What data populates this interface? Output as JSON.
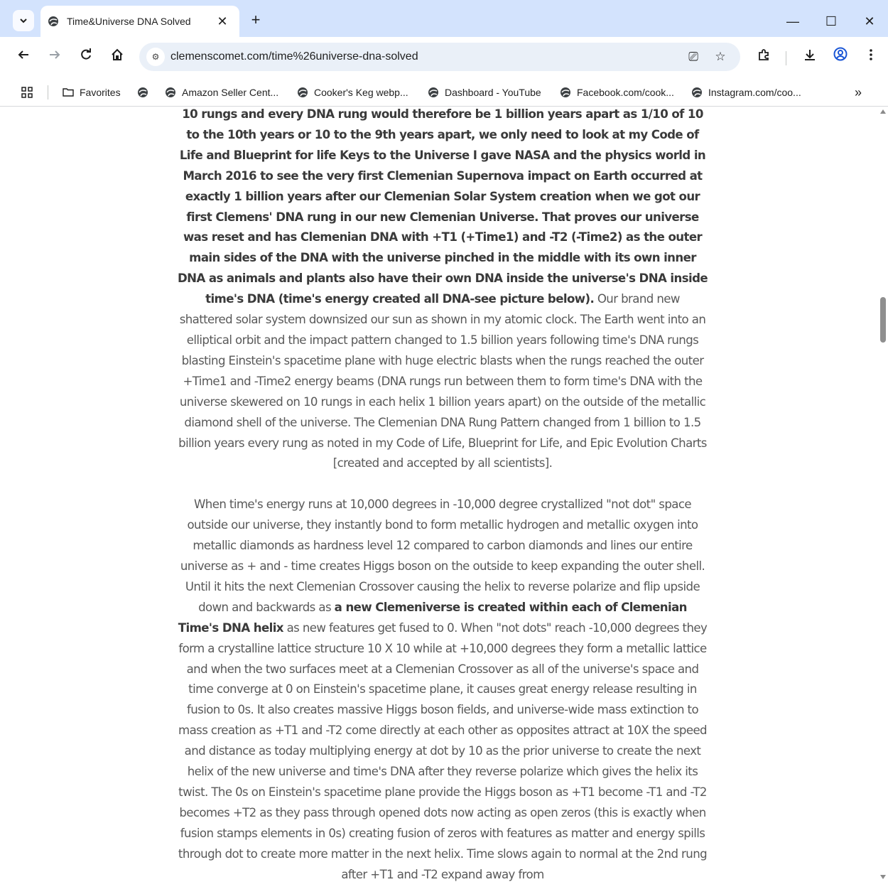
{
  "browser": {
    "tab": {
      "title": "Time&Universe DNA Solved"
    },
    "new_tab_label": "+",
    "window_controls": {
      "minimize": "—",
      "maximize": "☐",
      "close": "✕"
    },
    "address": {
      "url": "clemenscomet.com/time%26universe-dna-solved"
    },
    "bookmarks": {
      "favorites": "Favorites",
      "items": [
        "Amazon Seller Cent...",
        "Cooker's Keg webp...",
        "Dashboard - YouTube",
        "Facebook.com/cook...",
        "Instagram.com/coo..."
      ],
      "overflow": "»"
    }
  },
  "article": {
    "p1_bold": "10 rungs and every DNA rung would therefore be 1 billion years apart as 1/10 of 10 to the 10th years or 10 to the 9th years apart, we only need to look at my Code of Life and Blueprint for life Keys to the Universe I gave NASA and the physics world in March 2016 to see the very first Clemenian Supernova impact on Earth occurred at exactly 1 billion years after our Clemenian Solar System creation when we got our first Clemens' DNA rung in our new Clemenian Universe. That proves our universe was reset and has Clemenian DNA with +T1 (+Time1) and -T2 (-Time2) as the outer main sides of the DNA with the universe pinched in the middle with its own inner DNA as animals and plants also have their own DNA inside the universe's DNA inside time's DNA (time's energy created all DNA-see picture below).",
    "p1_rest": " Our brand new shattered solar system downsized our sun as shown in my atomic clock. The Earth went into an elliptical orbit and the impact pattern changed to 1.5 billion years following time's DNA rungs blasting Einstein's spacetime plane with huge electric blasts when the rungs reached the outer +Time1 and -Time2 energy beams (DNA rungs run between them to form time's DNA with the universe skewered on 10 rungs in each helix 1 billion years apart) on the outside of the metallic diamond shell of the universe. The Clemenian DNA Rung Pattern changed from 1 billion to 1.5 billion years every rung as noted in my Code of Life, Blueprint for Life, and Epic Evolution Charts [created and accepted by all scientists].",
    "p2_start": "When time's energy runs at 10,000 degrees in -10,000 degree crystallized \"not dot\" space outside our universe, they instantly bond to form metallic hydrogen and metallic oxygen into metallic diamonds as hardness level 12 compared to carbon diamonds and lines our entire universe as + and - time creates Higgs boson on the outside to keep expanding the outer shell. Until it hits the next Clemenian Crossover causing the helix to reverse polarize and flip upside down and backwards as ",
    "p2_bold": "a new Clemeniverse is created within each of Clemenian Time's DNA helix",
    "p2_rest": " as new features get fused to 0. When \"not dots\" reach -10,000 degrees they form a crystalline lattice structure 10 X 10 while at +10,000 degrees they form a metallic lattice and when the two surfaces meet at a Clemenian Crossover as all of the universe's space and time converge at 0 on Einstein's spacetime plane, it causes great energy release resulting in fusion to 0s. It also creates massive Higgs boson fields, and universe-wide mass extinction to mass creation as +T1 and -T2 come directly at each other as opposites attract at 10X the speed and distance as today multiplying energy at dot by 10 as the prior universe to create the next helix of the new universe and time's DNA after they reverse polarize which gives the helix its twist. The 0s on Einstein's spacetime plane provide the Higgs boson as +T1 become -T1 and -T2 becomes +T2 as they pass through opened dots now acting as open zeros (this is exactly when fusion stamps elements in 0s) creating fusion of zeros with features as matter and energy spills through dot to create more matter in the next helix. Time slows again to normal at the 2nd rung after +T1 and -T2 expand away from"
  }
}
